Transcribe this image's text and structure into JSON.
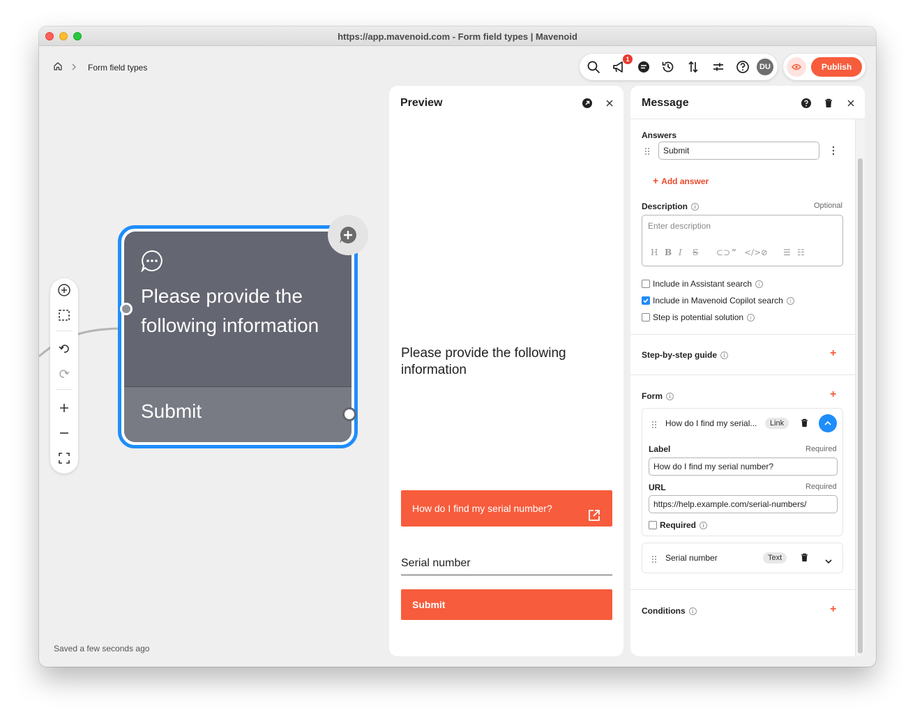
{
  "window": {
    "title": "https://app.mavenoid.com - Form field types | Mavenoid"
  },
  "breadcrumb": {
    "current": "Form field types"
  },
  "toolbar": {
    "notification_count": "1",
    "avatar_initials": "DU",
    "publish_label": "Publish",
    "icons": [
      "search-icon",
      "megaphone-icon",
      "chat-icon",
      "history-icon",
      "sort-icon",
      "sliders-icon",
      "help-icon"
    ]
  },
  "node": {
    "title": "Please provide the following information",
    "answer": "Submit"
  },
  "status": {
    "saved": "Saved a few seconds ago"
  },
  "preview": {
    "title": "Preview",
    "question": "Please provide the following information",
    "link_button": "How do I find my serial number?",
    "field_label": "Serial number",
    "submit_label": "Submit"
  },
  "message": {
    "title": "Message",
    "answers_label": "Answers",
    "answer_value": "Submit",
    "add_answer": "Add answer",
    "description_label": "Description",
    "description_optional": "Optional",
    "description_placeholder": "Enter description",
    "checkboxes": [
      {
        "label": "Include in Assistant search",
        "checked": false
      },
      {
        "label": "Include in Mavenoid Copilot search",
        "checked": true
      },
      {
        "label": "Step is potential solution",
        "checked": false
      }
    ],
    "guide_label": "Step-by-step guide",
    "form_label": "Form",
    "form_fields": [
      {
        "title": "How do I find my serial...",
        "type": "Link",
        "label_label": "Label",
        "label_required": "Required",
        "label_value": "How do I find my serial number?",
        "url_label": "URL",
        "url_required": "Required",
        "url_value": "https://help.example.com/serial-numbers/",
        "required_label": "Required"
      },
      {
        "title": "Serial number",
        "type": "Text"
      }
    ],
    "conditions_label": "Conditions"
  },
  "colors": {
    "accent": "#f75c3c",
    "selection": "#1f8dfa",
    "node": "#646671"
  }
}
